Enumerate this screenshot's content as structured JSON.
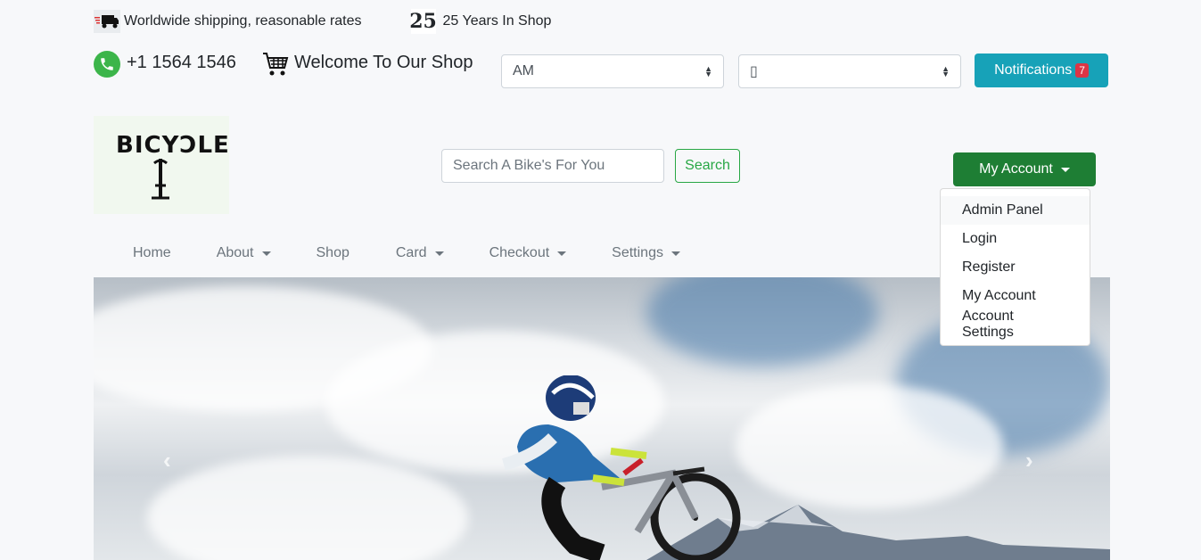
{
  "topbar": {
    "shipping_text": "Worldwide shipping, reasonable rates",
    "years_icon_glyph": "25",
    "years_text": "25 Years In Shop"
  },
  "contact": {
    "phone": "+1 1564 1546",
    "welcome": "Welcome To Our Shop"
  },
  "selects": {
    "time_format": "AM",
    "language": "▯"
  },
  "notifications": {
    "label": "Notifications",
    "count": "7"
  },
  "logo": {
    "text": "BICYƆLE"
  },
  "search": {
    "placeholder": "Search A Bike's For You",
    "button_label": "Search"
  },
  "account": {
    "button_label": "My Account",
    "menu": [
      {
        "label": "Admin Panel"
      },
      {
        "label": "Login"
      },
      {
        "label": "Register"
      },
      {
        "label": "My Account"
      },
      {
        "label": "Account Settings"
      }
    ]
  },
  "nav": {
    "items": [
      {
        "label": "Home"
      },
      {
        "label": "About"
      },
      {
        "label": "Shop"
      },
      {
        "label": "Card"
      },
      {
        "label": "Checkout"
      },
      {
        "label": "Settings"
      }
    ]
  },
  "carousel": {
    "prev_glyph": "‹",
    "next_glyph": "›"
  },
  "colors": {
    "notif_bg": "#17a2b8",
    "account_bg": "#1e7e34",
    "search_btn": "#28a745",
    "phone_icon": "#3cb54a",
    "badge": "#dc3545"
  }
}
